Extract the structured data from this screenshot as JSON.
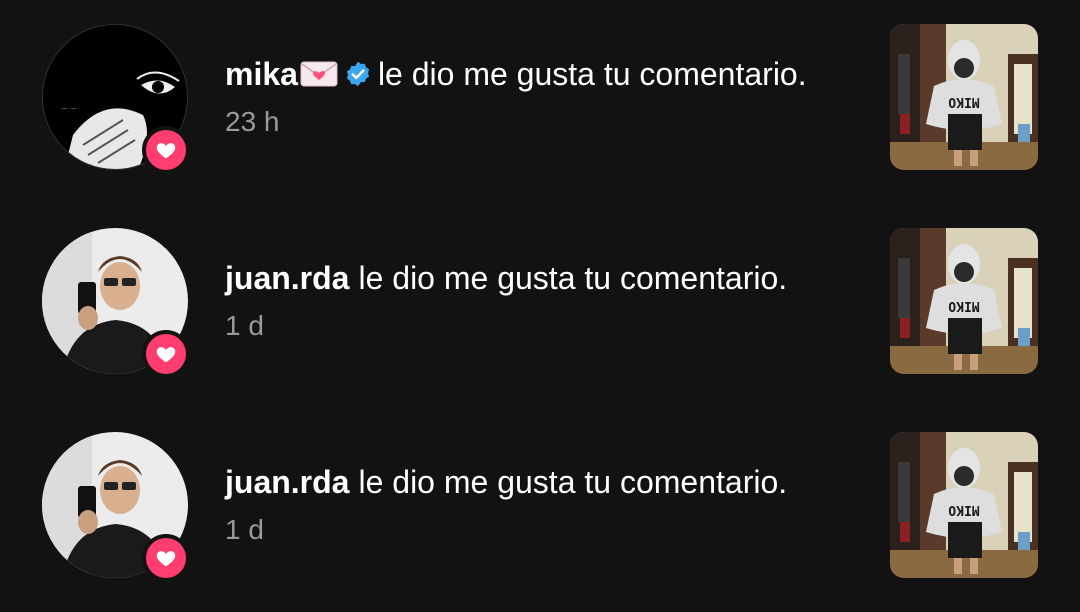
{
  "notifications": [
    {
      "username": "mika",
      "has_envelope_emoji": true,
      "verified": true,
      "action": "le dio me gusta tu comentario.",
      "time": "23 h",
      "avatar": "dark-artwork-avatar",
      "badge_icon": "heart-icon",
      "thumbnail": "hoodie-photo-thumbnail",
      "hoodie_text": "MIKO"
    },
    {
      "username": "juan.rda",
      "has_envelope_emoji": false,
      "verified": false,
      "action": "le dio me gusta tu comentario.",
      "time": "1 d",
      "avatar": "selfie-avatar",
      "badge_icon": "heart-icon",
      "thumbnail": "hoodie-photo-thumbnail",
      "hoodie_text": "MIKO"
    },
    {
      "username": "juan.rda",
      "has_envelope_emoji": false,
      "verified": false,
      "action": "le dio me gusta tu comentario.",
      "time": "1 d",
      "avatar": "selfie-avatar",
      "badge_icon": "heart-icon",
      "thumbnail": "hoodie-photo-thumbnail",
      "hoodie_text": "MIKO"
    }
  ],
  "colors": {
    "background": "#121212",
    "badge": "#ff3d6e",
    "verified": "#3aa8f0",
    "time_text": "#9a9a9a"
  }
}
